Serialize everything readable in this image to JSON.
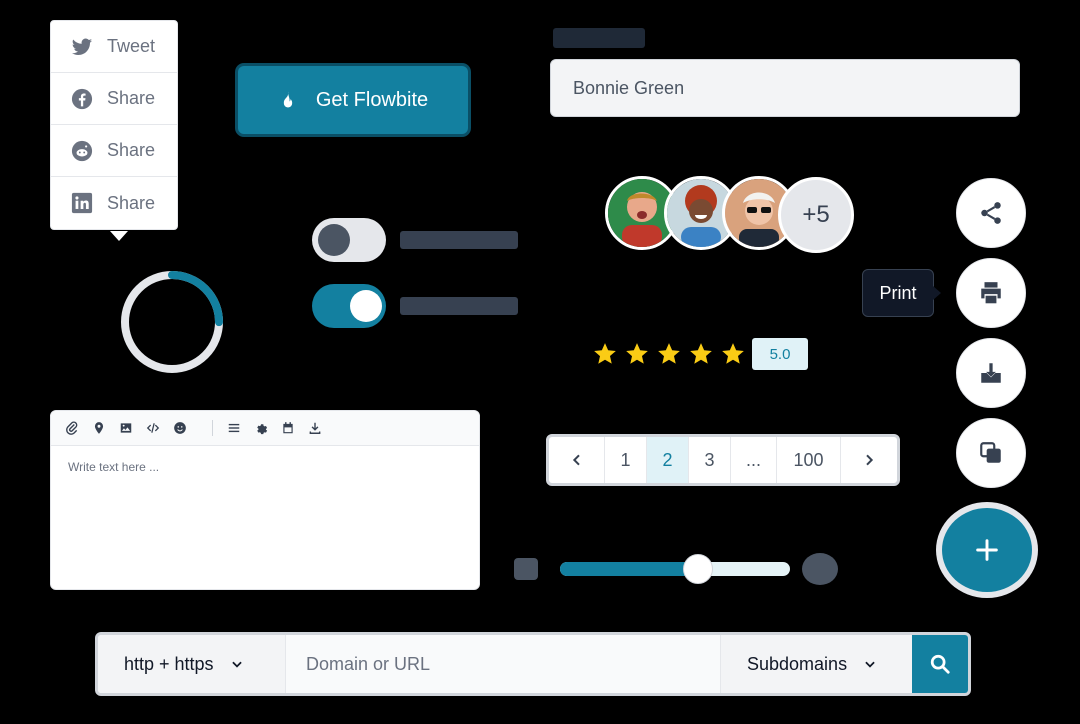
{
  "share_menu": {
    "items": [
      {
        "label": "Tweet",
        "icon": "twitter-icon"
      },
      {
        "label": "Share",
        "icon": "facebook-icon"
      },
      {
        "label": "Share",
        "icon": "reddit-icon"
      },
      {
        "label": "Share",
        "icon": "linkedin-icon"
      }
    ]
  },
  "cta_button": {
    "label": "Get Flowbite",
    "icon": "fire-icon"
  },
  "toggles": [
    {
      "checked": false
    },
    {
      "checked": true
    }
  ],
  "spinner": {
    "progress": 0.25
  },
  "editor": {
    "toolbar_icons": [
      "paperclip-icon",
      "map-pin-icon",
      "image-icon",
      "code-icon",
      "emoji-icon",
      "list-icon",
      "gear-icon",
      "calendar-icon",
      "download-icon"
    ],
    "placeholder": "Write text here ..."
  },
  "name_field": {
    "value": "Bonnie Green"
  },
  "avatars": {
    "more_label": "+5"
  },
  "rating": {
    "stars": 5,
    "value_label": "5.0"
  },
  "pagination": {
    "prev_icon": "chevron-left-icon",
    "pages": [
      "1",
      "2",
      "3",
      "...",
      "100"
    ],
    "active": "2",
    "next_icon": "chevron-right-icon"
  },
  "slider": {
    "value": 0.6
  },
  "speed_dial": {
    "actions": [
      "share-icon",
      "printer-icon",
      "download-icon",
      "copy-icon"
    ],
    "tooltip": "Print",
    "main_icon": "plus-icon"
  },
  "domain_search": {
    "protocol": "http + https",
    "placeholder": "Domain or URL",
    "scope": "Subdomains",
    "button_icon": "search-icon"
  },
  "colors": {
    "primary": "#1380a0",
    "star": "#facc15"
  }
}
